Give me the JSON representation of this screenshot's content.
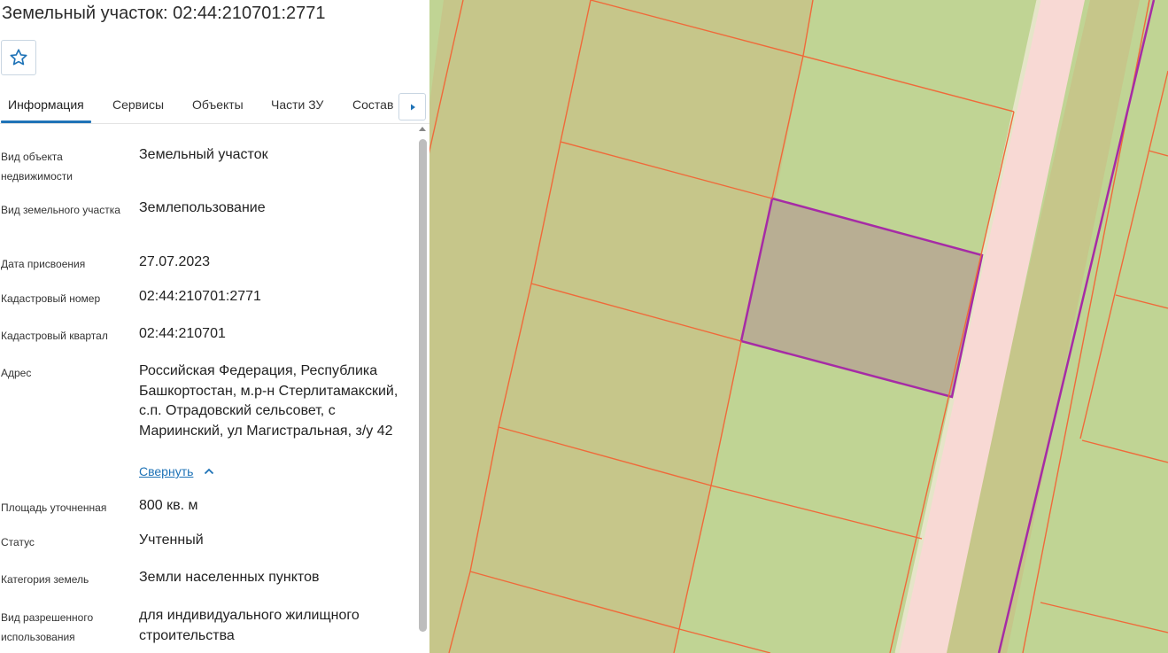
{
  "header": {
    "title": "Земельный участок: 02:44:210701:2771"
  },
  "favorite": {
    "icon": "star-outline-icon",
    "color": "#1f73b7"
  },
  "tabs": [
    {
      "label": "Информация",
      "active": true
    },
    {
      "label": "Сервисы"
    },
    {
      "label": "Объекты"
    },
    {
      "label": "Части ЗУ"
    },
    {
      "label": "Состав"
    }
  ],
  "tab_scroll_icon": "caret-right-icon",
  "info": {
    "rows": [
      {
        "label": "Вид объекта недвижимости",
        "value": "Земельный участок"
      },
      {
        "label": "Вид земельного участка",
        "value": "Землепользование"
      },
      {
        "label": "Дата присвоения",
        "value": "27.07.2023"
      },
      {
        "label": "Кадастровый номер",
        "value": "02:44:210701:2771"
      },
      {
        "label": "Кадастровый квартал",
        "value": "02:44:210701"
      },
      {
        "label": "Адрес",
        "value": "Российская Федерация, Республика Башкортостан, м.р-н Стерлитамакский, с.п. Отрадовский сельсовет, с Мариинский, ул Магистральная, з/у 42"
      },
      {
        "label": "Площадь уточненная",
        "value": "800 кв. м"
      },
      {
        "label": "Статус",
        "value": "Учтенный"
      },
      {
        "label": "Категория земель",
        "value": "Земли населенных пунктов"
      },
      {
        "label": "Вид разрешенного использования",
        "value": "для индивидуального жилищного строительства"
      }
    ],
    "collapse_label": "Свернуть",
    "collapse_icon": "chevron-up-icon"
  },
  "map": {
    "colors": {
      "background_green": "#c0d494",
      "parcel_olive": "#c6c68a",
      "selected_parcel_fill": "#b8ae93",
      "selected_parcel_border": "#a62ba6",
      "boundary_lines": "#ef6a3a",
      "road": "#f8d9d4"
    }
  }
}
